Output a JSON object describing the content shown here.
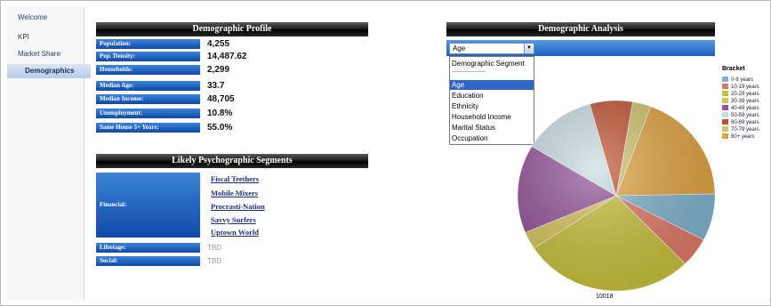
{
  "sidebar": {
    "items": [
      {
        "label": "Welcome"
      },
      {
        "label": "KPI"
      },
      {
        "label": "Market Share"
      },
      {
        "label": "Demographics",
        "active": true
      }
    ]
  },
  "demographic_profile": {
    "title": "Demographic Profile",
    "rows": [
      {
        "label": "Population:",
        "value": "4,255"
      },
      {
        "label": "Pop. Density:",
        "value": "14,487.62"
      },
      {
        "label": "Households:",
        "value": "2,299"
      },
      {
        "label": "Median Age:",
        "value": "33.7"
      },
      {
        "label": "Median Income:",
        "value": "48,705"
      },
      {
        "label": "Unemployment:",
        "value": "10.8%"
      },
      {
        "label": "Same House 5+ Years:",
        "value": "55.0%"
      }
    ]
  },
  "psychographic": {
    "title": "Likely Psychographic Segments",
    "financial_label": "Financial:",
    "financial_segments": [
      "Fiscal Teethers",
      "Mobile Mixers",
      "Procrasti-Nation",
      "Savvy Surfers",
      "Uptown World"
    ],
    "lifestage_label": "Lifestage:",
    "lifestage_value": "TBD",
    "social_label": "Social:",
    "social_value": "TBD"
  },
  "analysis": {
    "title": "Demographic Analysis",
    "selected": "Age",
    "options": [
      "Demographic Segment",
      "-------------------",
      "Age",
      "Education",
      "Ethnicity",
      "Household Income",
      "Marital Status",
      "Occupation"
    ],
    "caption": "10018"
  },
  "chart_data": {
    "type": "pie",
    "title": "",
    "legend_title": "Bracket",
    "legend_position": "right",
    "categories": [
      "0-9 years",
      "10-19 years",
      "20-29 years",
      "30-39 years",
      "40-49 years",
      "50-59 years",
      "60-69 years",
      "70-79 years",
      "80+ years"
    ],
    "values": [
      8,
      5,
      28,
      3,
      15,
      12,
      7,
      3,
      19
    ],
    "colors": [
      "#7db3cf",
      "#e07866",
      "#c8c23a",
      "#d9c45a",
      "#93519a",
      "#c9dde0",
      "#c0502f",
      "#d0c36a",
      "#e0a33e"
    ]
  }
}
